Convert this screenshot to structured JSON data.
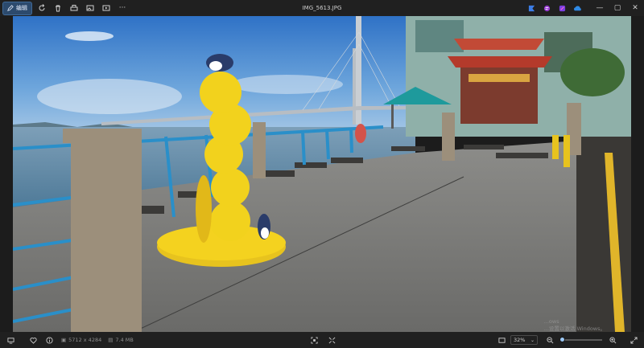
{
  "toolbar": {
    "edit_label": "编辑",
    "left_icons": [
      "rotate-icon",
      "delete-icon",
      "print-icon",
      "gallery-icon",
      "slideshow-icon",
      "more-icon"
    ],
    "more_label": "···"
  },
  "window": {
    "title": "IMG_5613.JPG",
    "minimize": "—",
    "maximize": "▢",
    "close": "✕"
  },
  "apps": [
    "bing-image-creator-icon",
    "clipchamp-icon",
    "designer-icon",
    "onedrive-icon"
  ],
  "status": {
    "dimensions": "5712 x 4284",
    "file_size": "7.4 MB",
    "zoom": "32%",
    "zoom_fraction": 0.32
  },
  "watermark": {
    "line1": "...ows",
    "line2": "...设置以激活 Windows。"
  },
  "colors": {
    "accent": "#2c4a6d",
    "slider": "#6aa6e8"
  }
}
